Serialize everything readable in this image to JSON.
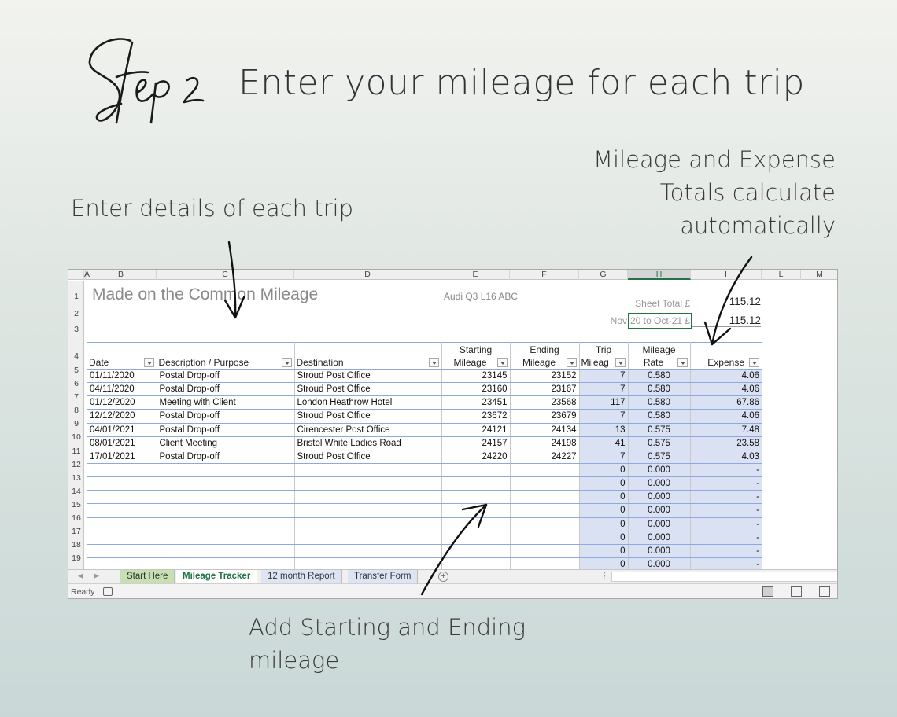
{
  "step_script": "Step 2",
  "headline": "Enter your mileage for each trip",
  "notes": {
    "left": "Enter details of each trip",
    "right": [
      "Mileage and Expense",
      "Totals calculate",
      "automatically"
    ],
    "bottom": [
      "Add Starting and Ending",
      "mileage"
    ]
  },
  "sheet": {
    "columns": [
      "A",
      "B",
      "C",
      "D",
      "E",
      "F",
      "G",
      "H",
      "I",
      "L",
      "M"
    ],
    "rows": [
      "1",
      "2",
      "3",
      "4",
      "5",
      "6",
      "7",
      "8",
      "9",
      "10",
      "11",
      "12",
      "13",
      "14",
      "15",
      "16",
      "17",
      "18",
      "19"
    ],
    "title": "Made on the Common Mileage",
    "vehicle": "Audi Q3 L16 ABC",
    "sheet_total_label": "Sheet Total £",
    "sheet_total_value": "115.12",
    "range_prefix": "Nov",
    "range_label": "20 to Oct-21 £",
    "range_value": "115.12",
    "headers": {
      "date": "Date",
      "description": "Description / Purpose",
      "destination": "Destination",
      "starting": [
        "Starting",
        "Mileage"
      ],
      "ending": [
        "Ending",
        "Mileage"
      ],
      "trip": [
        "Trip",
        "Mileag"
      ],
      "rate": [
        "Mileage",
        "Rate"
      ],
      "expense": "Expense"
    },
    "data_rows": [
      {
        "date": "01/11/2020",
        "desc": "Postal Drop-off",
        "dest": "Stroud Post Office",
        "start": "23145",
        "end": "23152",
        "trip": "7",
        "rate": "0.580",
        "expense": "4.06"
      },
      {
        "date": "04/11/2020",
        "desc": "Postal Drop-off",
        "dest": "Stroud Post Office",
        "start": "23160",
        "end": "23167",
        "trip": "7",
        "rate": "0.580",
        "expense": "4.06"
      },
      {
        "date": "01/12/2020",
        "desc": "Meeting with Client",
        "dest": "London Heathrow Hotel",
        "start": "23451",
        "end": "23568",
        "trip": "117",
        "rate": "0.580",
        "expense": "67.86"
      },
      {
        "date": "12/12/2020",
        "desc": "Postal Drop-off",
        "dest": "Stroud Post Office",
        "start": "23672",
        "end": "23679",
        "trip": "7",
        "rate": "0.580",
        "expense": "4.06"
      },
      {
        "date": "04/01/2021",
        "desc": "Postal Drop-off",
        "dest": "Cirencester Post Office",
        "start": "24121",
        "end": "24134",
        "trip": "13",
        "rate": "0.575",
        "expense": "7.48"
      },
      {
        "date": "08/01/2021",
        "desc": "Client Meeting",
        "dest": "Bristol White Ladies Road",
        "start": "24157",
        "end": "24198",
        "trip": "41",
        "rate": "0.575",
        "expense": "23.58"
      },
      {
        "date": "17/01/2021",
        "desc": "Postal Drop-off",
        "dest": "Stroud Post Office",
        "start": "24220",
        "end": "24227",
        "trip": "7",
        "rate": "0.575",
        "expense": "4.03"
      },
      {
        "date": "",
        "desc": "",
        "dest": "",
        "start": "",
        "end": "",
        "trip": "0",
        "rate": "0.000",
        "expense": "-"
      },
      {
        "date": "",
        "desc": "",
        "dest": "",
        "start": "",
        "end": "",
        "trip": "0",
        "rate": "0.000",
        "expense": "-"
      },
      {
        "date": "",
        "desc": "",
        "dest": "",
        "start": "",
        "end": "",
        "trip": "0",
        "rate": "0.000",
        "expense": "-"
      },
      {
        "date": "",
        "desc": "",
        "dest": "",
        "start": "",
        "end": "",
        "trip": "0",
        "rate": "0.000",
        "expense": "-"
      },
      {
        "date": "",
        "desc": "",
        "dest": "",
        "start": "",
        "end": "",
        "trip": "0",
        "rate": "0.000",
        "expense": "-"
      },
      {
        "date": "",
        "desc": "",
        "dest": "",
        "start": "",
        "end": "",
        "trip": "0",
        "rate": "0.000",
        "expense": "-"
      },
      {
        "date": "",
        "desc": "",
        "dest": "",
        "start": "",
        "end": "",
        "trip": "0",
        "rate": "0.000",
        "expense": "-"
      },
      {
        "date": "",
        "desc": "",
        "dest": "",
        "start": "",
        "end": "",
        "trip": "0",
        "rate": "0.000",
        "expense": "-"
      }
    ],
    "tabs": [
      "Start Here",
      "Mileage Tracker",
      "12 month Report",
      "Transfer Form"
    ],
    "status": "Ready"
  }
}
